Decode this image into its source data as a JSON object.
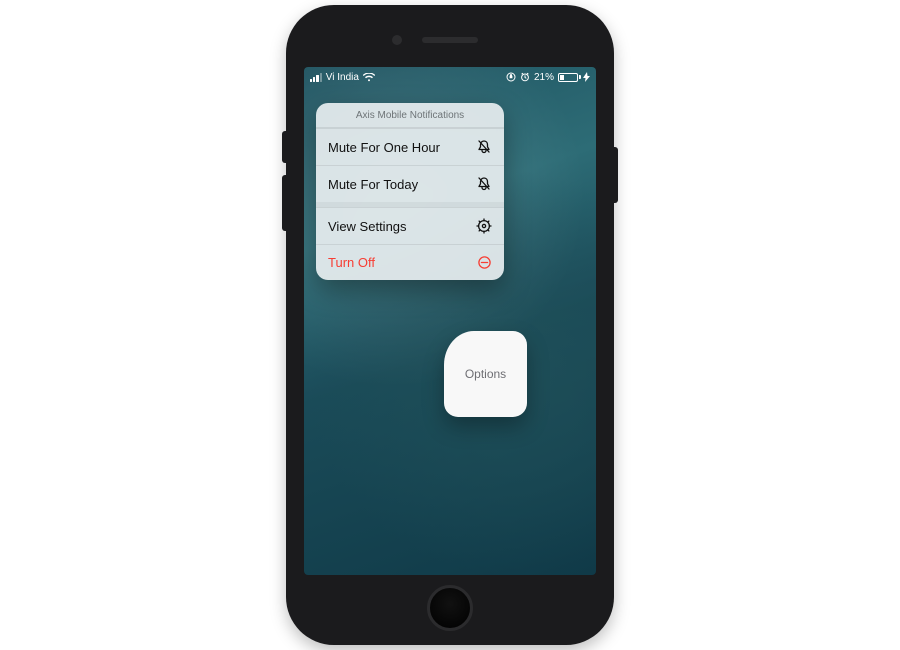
{
  "statusbar": {
    "carrier": "Vi India",
    "battery_percent_text": "21%",
    "battery_percent": 21
  },
  "menu": {
    "title": "Axis Mobile Notifications",
    "items": [
      {
        "label": "Mute For One Hour",
        "icon": "bell-slash-icon",
        "destructive": false
      },
      {
        "label": "Mute For Today",
        "icon": "bell-slash-icon",
        "destructive": false
      }
    ],
    "items2": [
      {
        "label": "View Settings",
        "icon": "gear-icon",
        "destructive": false
      },
      {
        "label": "Turn Off",
        "icon": "circle-minus-icon",
        "destructive": true
      }
    ]
  },
  "options_chip": {
    "label": "Options"
  }
}
